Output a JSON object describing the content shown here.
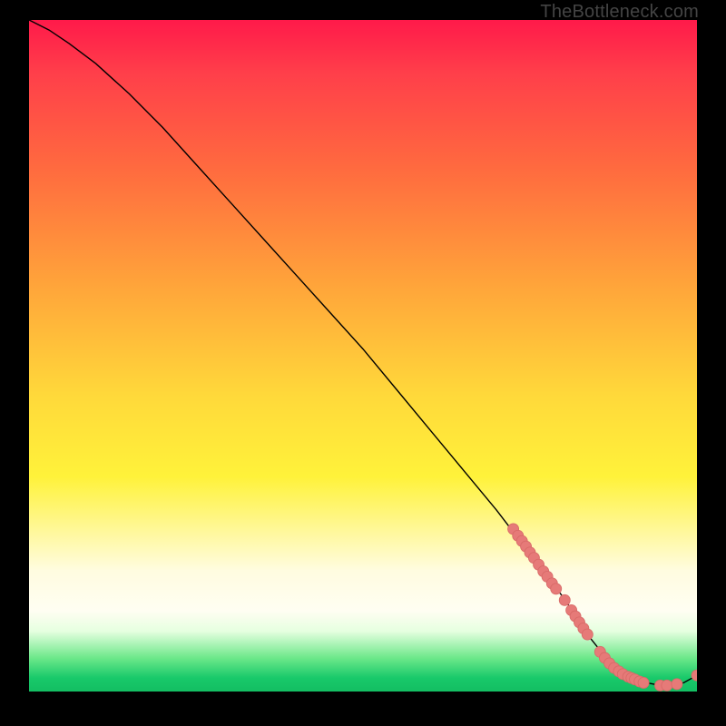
{
  "watermark": "TheBottleneck.com",
  "colors": {
    "curve": "#000000",
    "point_fill": "#e67a78",
    "point_stroke": "#d86a68",
    "bg": "#000000"
  },
  "chart_data": {
    "type": "line",
    "title": "",
    "xlabel": "",
    "ylabel": "",
    "xlim": [
      0,
      100
    ],
    "ylim": [
      0,
      100
    ],
    "grid": false,
    "legend": false,
    "series": [
      {
        "name": "bottleneck-curve",
        "x": [
          0,
          3,
          6,
          10,
          15,
          20,
          25,
          30,
          35,
          40,
          45,
          50,
          55,
          60,
          65,
          70,
          75,
          80,
          82,
          84,
          86,
          88,
          90,
          92,
          94,
          96,
          98,
          100
        ],
        "y": [
          100,
          98.5,
          96.5,
          93.5,
          89,
          84,
          78.5,
          73,
          67.5,
          62,
          56.5,
          51,
          45,
          39,
          33,
          27,
          20.5,
          14,
          11,
          8,
          5.5,
          3.5,
          2.2,
          1.4,
          1.0,
          0.9,
          1.3,
          2.4
        ]
      }
    ],
    "scatter": {
      "name": "highlighted-points",
      "points": [
        {
          "x": 72.5,
          "y": 24.2
        },
        {
          "x": 73.2,
          "y": 23.2
        },
        {
          "x": 73.8,
          "y": 22.4
        },
        {
          "x": 74.4,
          "y": 21.6
        },
        {
          "x": 75.0,
          "y": 20.7
        },
        {
          "x": 75.6,
          "y": 19.9
        },
        {
          "x": 76.3,
          "y": 18.9
        },
        {
          "x": 77.0,
          "y": 17.9
        },
        {
          "x": 77.6,
          "y": 17.1
        },
        {
          "x": 78.3,
          "y": 16.1
        },
        {
          "x": 78.9,
          "y": 15.3
        },
        {
          "x": 80.2,
          "y": 13.6
        },
        {
          "x": 81.2,
          "y": 12.1
        },
        {
          "x": 81.8,
          "y": 11.2
        },
        {
          "x": 82.4,
          "y": 10.3
        },
        {
          "x": 83.0,
          "y": 9.4
        },
        {
          "x": 83.6,
          "y": 8.5
        },
        {
          "x": 85.5,
          "y": 5.9
        },
        {
          "x": 86.2,
          "y": 5.0
        },
        {
          "x": 86.9,
          "y": 4.2
        },
        {
          "x": 87.6,
          "y": 3.5
        },
        {
          "x": 88.3,
          "y": 3.0
        },
        {
          "x": 88.9,
          "y": 2.6
        },
        {
          "x": 89.7,
          "y": 2.2
        },
        {
          "x": 90.2,
          "y": 2.0
        },
        {
          "x": 90.7,
          "y": 1.8
        },
        {
          "x": 91.4,
          "y": 1.5
        },
        {
          "x": 92.0,
          "y": 1.3
        },
        {
          "x": 94.5,
          "y": 0.9
        },
        {
          "x": 95.5,
          "y": 0.9
        },
        {
          "x": 97.0,
          "y": 1.1
        },
        {
          "x": 100.0,
          "y": 2.4
        }
      ]
    }
  }
}
